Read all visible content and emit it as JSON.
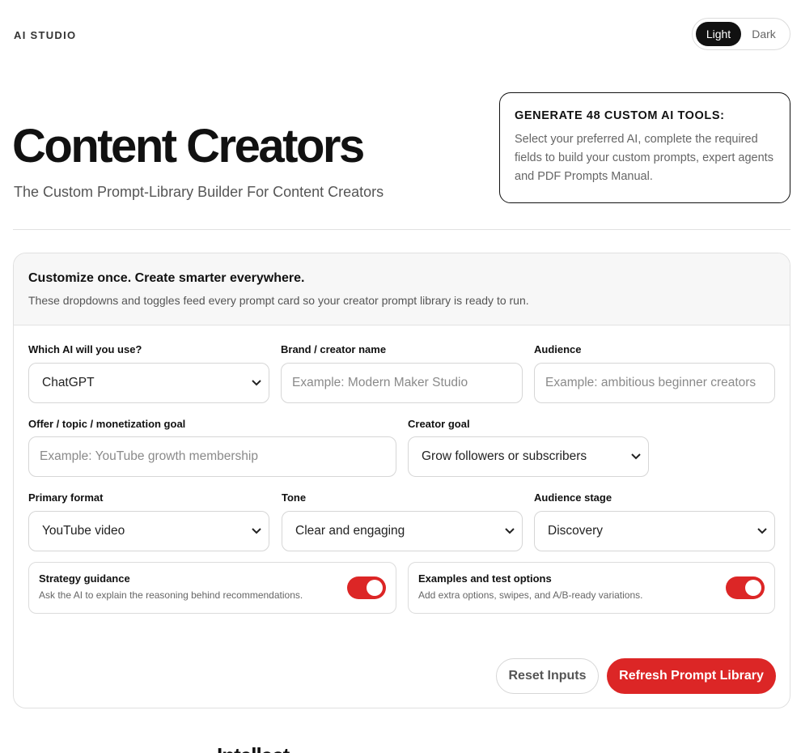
{
  "header": {
    "brand": "AI STUDIO",
    "theme": {
      "light_label": "Light",
      "dark_label": "Dark",
      "selected": "Light"
    }
  },
  "hero": {
    "title": "Content Creators",
    "subtitle": "The Custom Prompt-Library Builder For Content Creators"
  },
  "info_card": {
    "title": "GENERATE 48 CUSTOM AI TOOLS:",
    "text": "Select your preferred AI, complete the required fields to build your custom prompts, expert agents and PDF Prompts Manual."
  },
  "panel": {
    "title": "Customize once. Create smarter everywhere.",
    "description": "These dropdowns and toggles feed every prompt card so your creator prompt library is ready to run.",
    "fields": {
      "ai": {
        "label": "Which AI will you use?",
        "value": "ChatGPT"
      },
      "brand": {
        "label": "Brand / creator name",
        "placeholder": "Example: Modern Maker Studio"
      },
      "audience": {
        "label": "Audience",
        "placeholder": "Example: ambitious beginner creators"
      },
      "offer": {
        "label": "Offer / topic / monetization goal",
        "placeholder": "Example: YouTube growth membership"
      },
      "goal": {
        "label": "Creator goal",
        "value": "Grow followers or subscribers"
      },
      "format": {
        "label": "Primary format",
        "value": "YouTube video"
      },
      "tone": {
        "label": "Tone",
        "value": "Clear and engaging"
      },
      "stage": {
        "label": "Audience stage",
        "value": "Discovery"
      }
    },
    "toggles": {
      "strategy": {
        "title": "Strategy guidance",
        "description": "Ask the AI to explain the reasoning behind recommendations.",
        "on": true
      },
      "examples": {
        "title": "Examples and test options",
        "description": "Add extra options, swipes, and A/B-ready variations.",
        "on": true
      }
    },
    "buttons": {
      "reset": "Reset Inputs",
      "refresh": "Refresh Prompt Library"
    }
  },
  "colors": {
    "accent": "#dc2626",
    "ink": "#111111",
    "muted": "#555555"
  },
  "footer_cut_text": "Intellect"
}
